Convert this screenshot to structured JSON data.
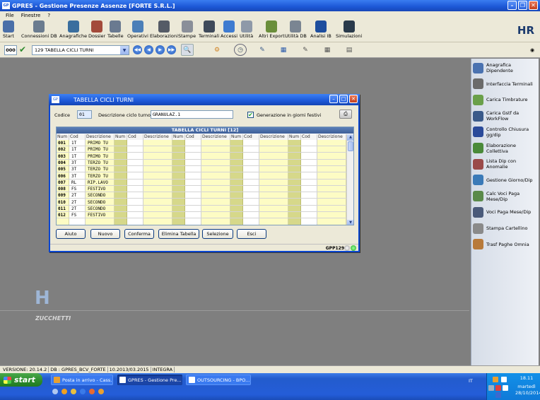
{
  "window": {
    "title": "GPRES - Gestione Presenze Assenze  [FORTE S.R.L.]",
    "app_icon": "GP"
  },
  "menu": [
    "File",
    "Finestre",
    "?"
  ],
  "toolbar": {
    "items": [
      {
        "label": "Start",
        "icon": "home-icon",
        "color": "#4a6fa8"
      },
      {
        "label": "Connessioni DB",
        "icon": "database-icon",
        "color": "#6b7c8f"
      },
      {
        "label": "Anagrafiche",
        "icon": "people-icon",
        "color": "#3a6e9e"
      },
      {
        "label": "Dossier",
        "icon": "dossier-icon",
        "color": "#a34a3a"
      },
      {
        "label": "Tabelle",
        "icon": "table-icon",
        "color": "#6a7a90"
      },
      {
        "label": "Operativi",
        "icon": "operations-icon",
        "color": "#4b7fb8"
      },
      {
        "label": "Elaborazioni",
        "icon": "gear-icon",
        "color": "#555b66"
      },
      {
        "label": "Stampe",
        "icon": "printer-icon",
        "color": "#8a8f99"
      },
      {
        "label": "Terminali",
        "icon": "terminal-icon",
        "color": "#3f4a5a"
      },
      {
        "label": "Accessi",
        "icon": "key-icon",
        "color": "#3e7bd0"
      },
      {
        "label": "Utilità",
        "icon": "tools-icon",
        "color": "#8e99a8"
      },
      {
        "label": "Altri Export",
        "icon": "export-icon",
        "color": "#6a8e3a"
      },
      {
        "label": "Utilità DB",
        "icon": "db-tools-icon",
        "color": "#7a8592"
      },
      {
        "label": "Analisi IB",
        "icon": "analysis-icon",
        "color": "#1e4e9e"
      },
      {
        "label": "Simulazioni",
        "icon": "simulation-icon",
        "color": "#2a3a4a"
      }
    ],
    "logo": "HR"
  },
  "toolbar2": {
    "code_box": "000",
    "combo_value": "129 TABELLA CICLI TURNI"
  },
  "dialog": {
    "title": "TABELLA CICLI TURNI",
    "codice_label": "Codice",
    "codice_value": "01",
    "descrizione_label": "Descrizione ciclo turno",
    "descrizione_value": "GRANULAZ.1",
    "festivi_label": "Generazione in giorni festivi",
    "festivi_checked": true,
    "grid_title": "TABELLA CICLI TURNI [12]",
    "columns": [
      "Num",
      "Cod",
      "Descrizione",
      "Num",
      "Cod",
      "Descrizione",
      "Num",
      "Cod",
      "Descrizione",
      "Num",
      "Cod",
      "Descrizione",
      "Num",
      "Cod",
      "Descrizione"
    ],
    "rows": [
      {
        "num": "001",
        "cod": "1T",
        "desc": "PRIMO TU"
      },
      {
        "num": "002",
        "cod": "1T",
        "desc": "PRIMO TU"
      },
      {
        "num": "003",
        "cod": "1T",
        "desc": "PRIMO TU"
      },
      {
        "num": "004",
        "cod": "3T",
        "desc": "TERZO TU"
      },
      {
        "num": "005",
        "cod": "3T",
        "desc": "TERZO TU"
      },
      {
        "num": "006",
        "cod": "3T",
        "desc": "TERZO TU"
      },
      {
        "num": "007",
        "cod": "RL",
        "desc": "RIP.LAVO"
      },
      {
        "num": "008",
        "cod": "FS",
        "desc": "FESTIVO"
      },
      {
        "num": "009",
        "cod": "2T",
        "desc": "SECONDO"
      },
      {
        "num": "010",
        "cod": "2T",
        "desc": "SECONDO"
      },
      {
        "num": "011",
        "cod": "2T",
        "desc": "SECONDO"
      },
      {
        "num": "012",
        "cod": "FS",
        "desc": "FESTIVO"
      }
    ],
    "buttons": [
      "Aiuto",
      "Nuovo",
      "Conferma",
      "Elimina Tabella",
      "Selezione",
      "Esci"
    ],
    "status_code": "GPP129"
  },
  "sidepanel": [
    {
      "label": "Anagrafica Dipendente",
      "icon": "employee-icon",
      "color": "#4a72b0"
    },
    {
      "label": "Interfaccia Terminali",
      "icon": "terminal-interface-icon",
      "color": "#6a6a6a"
    },
    {
      "label": "Carica Timbrature",
      "icon": "clock-load-icon",
      "color": "#6aa04a"
    },
    {
      "label": "Carica Gstf da WorkFlow",
      "icon": "workflow-icon",
      "color": "#3a5a8a"
    },
    {
      "label": "Controllo Chiusura gg/dip",
      "icon": "control-icon",
      "color": "#2a4a9a"
    },
    {
      "label": "Elaborazione Collettiva",
      "icon": "collective-icon",
      "color": "#4a8a3a"
    },
    {
      "label": "Lista Dip con Anomalie",
      "icon": "anomaly-list-icon",
      "color": "#9a4a4a"
    },
    {
      "label": "Gestione Giorno/Dip",
      "icon": "day-manage-icon",
      "color": "#3a7ab8"
    },
    {
      "label": "Calc Voci Paga Mese/Dip",
      "icon": "calc-icon",
      "color": "#5a8a4a"
    },
    {
      "label": "Voci Paga Mese/Dip",
      "icon": "pay-items-icon",
      "color": "#4a5a7a"
    },
    {
      "label": "Stampa Cartellino",
      "icon": "print-card-icon",
      "color": "#8a8a8a"
    },
    {
      "label": "Trasf Paghe Omnia",
      "icon": "transfer-icon",
      "color": "#b87a3a"
    }
  ],
  "branding": {
    "zucchetti": "ZUCCHETTI"
  },
  "version_bar": [
    "VERSIONE: 20.14.2",
    "DB : GPRES_BCV_FORTE",
    "10.2013/03.2015",
    "INTEGRA"
  ],
  "taskbar": {
    "start": "start",
    "tasks": [
      {
        "label": "Posta in arrivo - Cass...",
        "color": "#e8a030",
        "active": false
      },
      {
        "label": "GPRES - Gestione Pre...",
        "color": "#2a5ac8",
        "active": true
      },
      {
        "label": "OUTSOURCING - BPO...",
        "color": "#2a5ab8",
        "active": false
      }
    ],
    "lang": "IT",
    "time": "18.11",
    "day": "martedì",
    "date": "28/10/2014"
  }
}
